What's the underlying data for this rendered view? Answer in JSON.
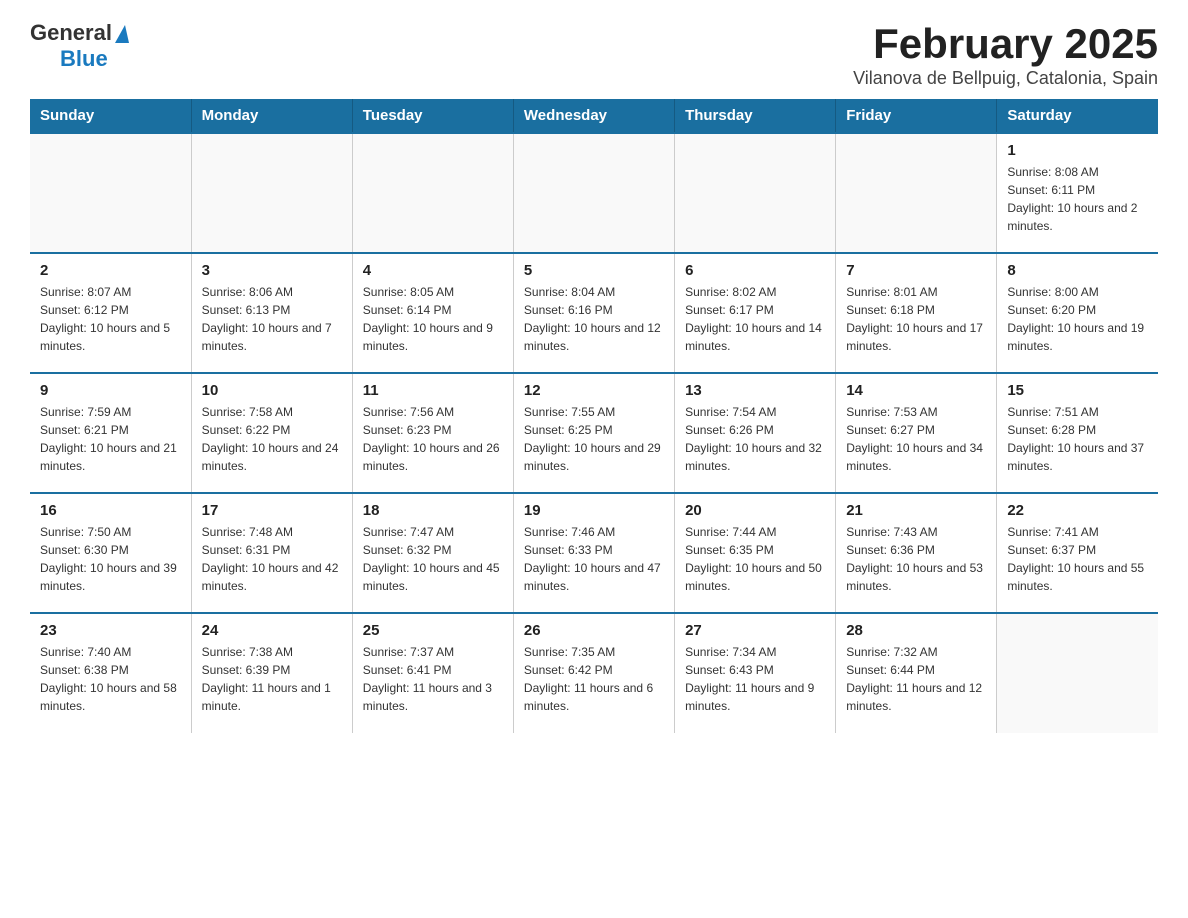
{
  "logo": {
    "general": "General",
    "triangle_label": "triangle-icon",
    "blue": "Blue"
  },
  "title": "February 2025",
  "subtitle": "Vilanova de Bellpuig, Catalonia, Spain",
  "weekdays": [
    "Sunday",
    "Monday",
    "Tuesday",
    "Wednesday",
    "Thursday",
    "Friday",
    "Saturday"
  ],
  "weeks": [
    [
      {
        "day": "",
        "info": ""
      },
      {
        "day": "",
        "info": ""
      },
      {
        "day": "",
        "info": ""
      },
      {
        "day": "",
        "info": ""
      },
      {
        "day": "",
        "info": ""
      },
      {
        "day": "",
        "info": ""
      },
      {
        "day": "1",
        "info": "Sunrise: 8:08 AM\nSunset: 6:11 PM\nDaylight: 10 hours and 2 minutes."
      }
    ],
    [
      {
        "day": "2",
        "info": "Sunrise: 8:07 AM\nSunset: 6:12 PM\nDaylight: 10 hours and 5 minutes."
      },
      {
        "day": "3",
        "info": "Sunrise: 8:06 AM\nSunset: 6:13 PM\nDaylight: 10 hours and 7 minutes."
      },
      {
        "day": "4",
        "info": "Sunrise: 8:05 AM\nSunset: 6:14 PM\nDaylight: 10 hours and 9 minutes."
      },
      {
        "day": "5",
        "info": "Sunrise: 8:04 AM\nSunset: 6:16 PM\nDaylight: 10 hours and 12 minutes."
      },
      {
        "day": "6",
        "info": "Sunrise: 8:02 AM\nSunset: 6:17 PM\nDaylight: 10 hours and 14 minutes."
      },
      {
        "day": "7",
        "info": "Sunrise: 8:01 AM\nSunset: 6:18 PM\nDaylight: 10 hours and 17 minutes."
      },
      {
        "day": "8",
        "info": "Sunrise: 8:00 AM\nSunset: 6:20 PM\nDaylight: 10 hours and 19 minutes."
      }
    ],
    [
      {
        "day": "9",
        "info": "Sunrise: 7:59 AM\nSunset: 6:21 PM\nDaylight: 10 hours and 21 minutes."
      },
      {
        "day": "10",
        "info": "Sunrise: 7:58 AM\nSunset: 6:22 PM\nDaylight: 10 hours and 24 minutes."
      },
      {
        "day": "11",
        "info": "Sunrise: 7:56 AM\nSunset: 6:23 PM\nDaylight: 10 hours and 26 minutes."
      },
      {
        "day": "12",
        "info": "Sunrise: 7:55 AM\nSunset: 6:25 PM\nDaylight: 10 hours and 29 minutes."
      },
      {
        "day": "13",
        "info": "Sunrise: 7:54 AM\nSunset: 6:26 PM\nDaylight: 10 hours and 32 minutes."
      },
      {
        "day": "14",
        "info": "Sunrise: 7:53 AM\nSunset: 6:27 PM\nDaylight: 10 hours and 34 minutes."
      },
      {
        "day": "15",
        "info": "Sunrise: 7:51 AM\nSunset: 6:28 PM\nDaylight: 10 hours and 37 minutes."
      }
    ],
    [
      {
        "day": "16",
        "info": "Sunrise: 7:50 AM\nSunset: 6:30 PM\nDaylight: 10 hours and 39 minutes."
      },
      {
        "day": "17",
        "info": "Sunrise: 7:48 AM\nSunset: 6:31 PM\nDaylight: 10 hours and 42 minutes."
      },
      {
        "day": "18",
        "info": "Sunrise: 7:47 AM\nSunset: 6:32 PM\nDaylight: 10 hours and 45 minutes."
      },
      {
        "day": "19",
        "info": "Sunrise: 7:46 AM\nSunset: 6:33 PM\nDaylight: 10 hours and 47 minutes."
      },
      {
        "day": "20",
        "info": "Sunrise: 7:44 AM\nSunset: 6:35 PM\nDaylight: 10 hours and 50 minutes."
      },
      {
        "day": "21",
        "info": "Sunrise: 7:43 AM\nSunset: 6:36 PM\nDaylight: 10 hours and 53 minutes."
      },
      {
        "day": "22",
        "info": "Sunrise: 7:41 AM\nSunset: 6:37 PM\nDaylight: 10 hours and 55 minutes."
      }
    ],
    [
      {
        "day": "23",
        "info": "Sunrise: 7:40 AM\nSunset: 6:38 PM\nDaylight: 10 hours and 58 minutes."
      },
      {
        "day": "24",
        "info": "Sunrise: 7:38 AM\nSunset: 6:39 PM\nDaylight: 11 hours and 1 minute."
      },
      {
        "day": "25",
        "info": "Sunrise: 7:37 AM\nSunset: 6:41 PM\nDaylight: 11 hours and 3 minutes."
      },
      {
        "day": "26",
        "info": "Sunrise: 7:35 AM\nSunset: 6:42 PM\nDaylight: 11 hours and 6 minutes."
      },
      {
        "day": "27",
        "info": "Sunrise: 7:34 AM\nSunset: 6:43 PM\nDaylight: 11 hours and 9 minutes."
      },
      {
        "day": "28",
        "info": "Sunrise: 7:32 AM\nSunset: 6:44 PM\nDaylight: 11 hours and 12 minutes."
      },
      {
        "day": "",
        "info": ""
      }
    ]
  ]
}
